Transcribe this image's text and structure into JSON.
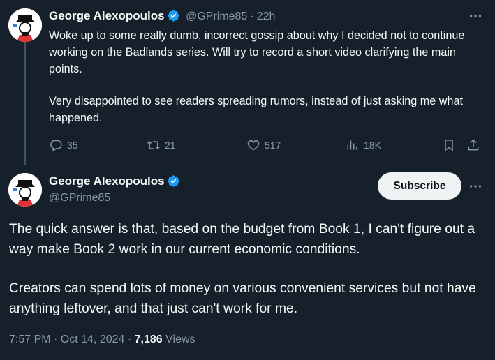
{
  "reply_tweet": {
    "author_name": "George Alexopoulos",
    "handle": "@GPrime85",
    "separator": "·",
    "time_ago": "22h",
    "paragraphs": [
      "Woke up to some really dumb, incorrect gossip about why I decided not to continue working on the Badlands series. Will try to record a short video clarifying the main points.",
      "Very disappointed to see readers spreading rumors, instead of just asking me what happened."
    ],
    "actions": {
      "replies": "35",
      "reposts": "21",
      "likes": "517",
      "views": "18K"
    }
  },
  "main_tweet": {
    "author_name": "George Alexopoulos",
    "handle": "@GPrime85",
    "subscribe_label": "Subscribe",
    "paragraphs": [
      "The quick answer is that, based on the budget from Book 1, I can't figure out a way make Book 2 work in our current economic conditions.",
      "Creators can spend lots of money on various convenient services but not have anything leftover, and that just can't work for me."
    ],
    "timestamp": "7:57 PM · Oct 14, 2024 · ",
    "views_count": "7,186",
    "views_label": " Views"
  },
  "colors": {
    "background": "#15202b",
    "text_primary": "#f7f9f9",
    "text_secondary": "#8b98a5",
    "verified_blue": "#1d9bf0",
    "thread_line": "#425364"
  },
  "icons": [
    "avatar",
    "verified-badge-icon",
    "more-icon",
    "reply-icon",
    "repost-icon",
    "like-icon",
    "views-icon",
    "bookmark-icon",
    "share-icon"
  ]
}
